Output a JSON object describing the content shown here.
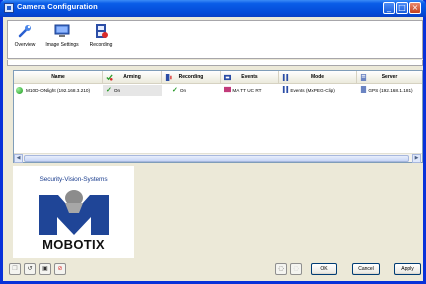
{
  "window": {
    "title": "Camera Configuration"
  },
  "toolbar": {
    "items": [
      {
        "label": "Overview",
        "icon": "wrench-icon"
      },
      {
        "label": "Image Settings",
        "icon": "monitor-icon"
      },
      {
        "label": "Recording",
        "icon": "film-icon"
      }
    ]
  },
  "grid": {
    "columns": [
      "Name",
      "Arming",
      "Recording",
      "Events",
      "Mode",
      "Server"
    ],
    "rows": [
      {
        "name": "M10D-ONlight (192.168.3.210)",
        "arming": "On",
        "recording": "On",
        "events": "MA TT UC RT",
        "mode": "Events (MxPEG-Clip)",
        "server": "GPS (192.168.1.181)"
      }
    ]
  },
  "logo": {
    "top_text": "Security-Vision-Systems",
    "brand": "MOBOTIX"
  },
  "buttons": {
    "ok": "OK",
    "cancel": "Cancel",
    "apply": "Apply"
  },
  "colors": {
    "titlebar": "#0a5de8",
    "window_bg": "#ece9d8",
    "logo_blue": "#1d3f8f",
    "status_green": "#1c9a1c"
  }
}
